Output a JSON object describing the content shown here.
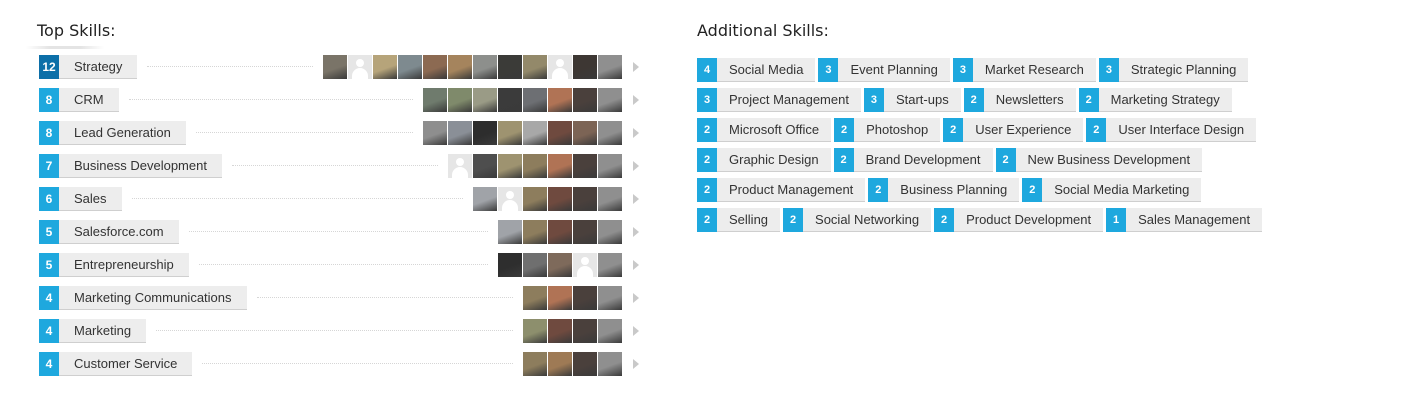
{
  "top_skills": {
    "title": "Top Skills:",
    "rows": [
      {
        "count": "12",
        "label": "Strategy",
        "avatars": [
          "#7a7468",
          "#cfcfcf",
          "#b6a47a",
          "#7e8a8f",
          "#8c6a52",
          "#a5845d",
          "#8d8f8c",
          "#3b3b38",
          "#93896a",
          "#d8d8d8",
          "#3d3733",
          "#8f8f8f"
        ]
      },
      {
        "count": "8",
        "label": "CRM",
        "avatars": [
          "#6f7b6d",
          "#7f8a6b",
          "#9a9b86",
          "#3b3b3b",
          "#6d6f73",
          "#b07355",
          "#4a403c",
          "#8f8f8f"
        ]
      },
      {
        "count": "8",
        "label": "Lead Generation",
        "avatars": [
          "#8e8e8e",
          "#8a8f97",
          "#2d2d2d",
          "#9e9370",
          "#a8a8a8",
          "#6f4a3f",
          "#7c6455",
          "#8f8f8f"
        ]
      },
      {
        "count": "7",
        "label": "Business Development",
        "avatars": [
          "#cfcfcf",
          "#4e4e4e",
          "#9e9370",
          "#8d7d5d",
          "#b07355",
          "#4a403c",
          "#8f8f8f"
        ]
      },
      {
        "count": "6",
        "label": "Sales",
        "avatars": [
          "#a0a3a8",
          "#d8d8d8",
          "#8d7d5d",
          "#6f4a3f",
          "#4a403c",
          "#8f8f8f"
        ]
      },
      {
        "count": "5",
        "label": "Salesforce.com",
        "avatars": [
          "#a0a3a8",
          "#8d7d5d",
          "#6f4a3f",
          "#4a403c",
          "#8f8f8f"
        ]
      },
      {
        "count": "5",
        "label": "Entrepreneurship",
        "avatars": [
          "#2e2e2e",
          "#6f6f6f",
          "#7e6a5b",
          "#d8d8d8",
          "#8f8f8f"
        ]
      },
      {
        "count": "4",
        "label": "Marketing Communications",
        "avatars": [
          "#8d7d5d",
          "#b07355",
          "#4a403c",
          "#8f8f8f"
        ]
      },
      {
        "count": "4",
        "label": "Marketing",
        "avatars": [
          "#8d8f6d",
          "#6f4a3f",
          "#4a403c",
          "#8f8f8f"
        ]
      },
      {
        "count": "4",
        "label": "Customer Service",
        "avatars": [
          "#8d7d5d",
          "#9e7a55",
          "#4a403c",
          "#8f8f8f"
        ]
      }
    ]
  },
  "additional_skills": {
    "title": "Additional Skills:",
    "rows": [
      [
        {
          "count": "4",
          "label": "Social Media"
        },
        {
          "count": "3",
          "label": "Event Planning"
        },
        {
          "count": "3",
          "label": "Market Research"
        },
        {
          "count": "3",
          "label": "Strategic Planning"
        }
      ],
      [
        {
          "count": "3",
          "label": "Project Management"
        },
        {
          "count": "3",
          "label": "Start-ups"
        },
        {
          "count": "2",
          "label": "Newsletters"
        },
        {
          "count": "2",
          "label": "Marketing Strategy"
        }
      ],
      [
        {
          "count": "2",
          "label": "Microsoft Office"
        },
        {
          "count": "2",
          "label": "Photoshop"
        },
        {
          "count": "2",
          "label": "User Experience"
        },
        {
          "count": "2",
          "label": "User Interface Design"
        }
      ],
      [
        {
          "count": "2",
          "label": "Graphic Design"
        },
        {
          "count": "2",
          "label": "Brand Development"
        },
        {
          "count": "2",
          "label": "New Business Development"
        }
      ],
      [
        {
          "count": "2",
          "label": "Product Management"
        },
        {
          "count": "2",
          "label": "Business Planning"
        },
        {
          "count": "2",
          "label": "Social Media Marketing"
        }
      ],
      [
        {
          "count": "2",
          "label": "Selling"
        },
        {
          "count": "2",
          "label": "Social Networking"
        },
        {
          "count": "2",
          "label": "Product Development"
        },
        {
          "count": "1",
          "label": "Sales Management"
        }
      ]
    ]
  },
  "colors": {
    "badge": "#1ea8de",
    "badge_top": "#0c6fa8",
    "pill": "#ededed"
  }
}
